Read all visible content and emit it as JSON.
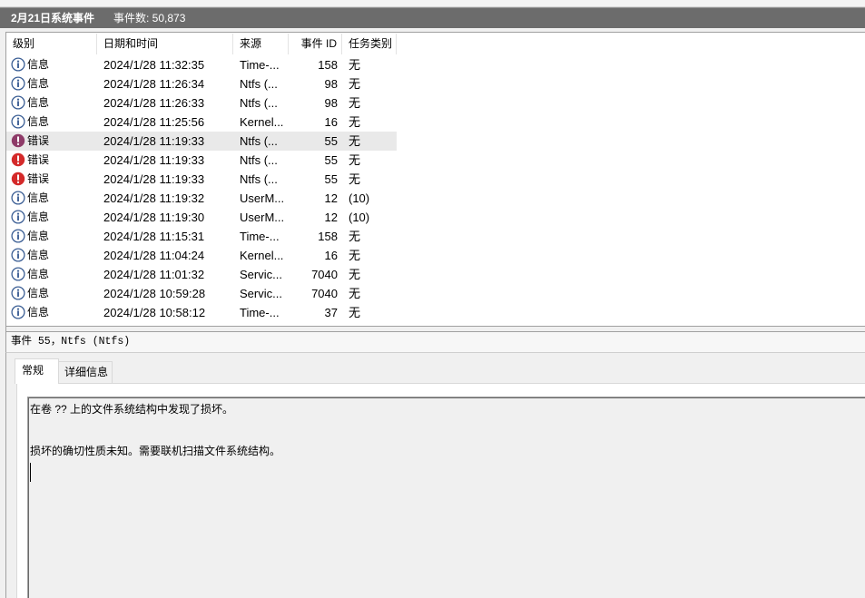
{
  "header": {
    "title": "2月21日系统事件",
    "count_label": "事件数: 50,873"
  },
  "table": {
    "columns": [
      "级别",
      "日期和时间",
      "来源",
      "事件 ID",
      "任务类别"
    ],
    "rows": [
      {
        "icon": "info-icon",
        "level": "信息",
        "datetime": "2024/1/28 11:32:35",
        "source": "Time-...",
        "event_id": "158",
        "task": "无"
      },
      {
        "icon": "info-icon",
        "level": "信息",
        "datetime": "2024/1/28 11:26:34",
        "source": "Ntfs (...",
        "event_id": "98",
        "task": "无"
      },
      {
        "icon": "info-icon",
        "level": "信息",
        "datetime": "2024/1/28 11:26:33",
        "source": "Ntfs (...",
        "event_id": "98",
        "task": "无"
      },
      {
        "icon": "info-icon",
        "level": "信息",
        "datetime": "2024/1/28 11:25:56",
        "source": "Kernel...",
        "event_id": "16",
        "task": "无"
      },
      {
        "icon": "error-icon",
        "level": "错误",
        "datetime": "2024/1/28 11:19:33",
        "source": "Ntfs (...",
        "event_id": "55",
        "task": "无",
        "selected": true
      },
      {
        "icon": "error-icon",
        "level": "错误",
        "datetime": "2024/1/28 11:19:33",
        "source": "Ntfs (...",
        "event_id": "55",
        "task": "无"
      },
      {
        "icon": "error-icon",
        "level": "错误",
        "datetime": "2024/1/28 11:19:33",
        "source": "Ntfs (...",
        "event_id": "55",
        "task": "无"
      },
      {
        "icon": "info-icon",
        "level": "信息",
        "datetime": "2024/1/28 11:19:32",
        "source": "UserM...",
        "event_id": "12",
        "task": "(10)"
      },
      {
        "icon": "info-icon",
        "level": "信息",
        "datetime": "2024/1/28 11:19:30",
        "source": "UserM...",
        "event_id": "12",
        "task": "(10)"
      },
      {
        "icon": "info-icon",
        "level": "信息",
        "datetime": "2024/1/28 11:15:31",
        "source": "Time-...",
        "event_id": "158",
        "task": "无"
      },
      {
        "icon": "info-icon",
        "level": "信息",
        "datetime": "2024/1/28 11:04:24",
        "source": "Kernel...",
        "event_id": "16",
        "task": "无"
      },
      {
        "icon": "info-icon",
        "level": "信息",
        "datetime": "2024/1/28 11:01:32",
        "source": "Servic...",
        "event_id": "7040",
        "task": "无"
      },
      {
        "icon": "info-icon",
        "level": "信息",
        "datetime": "2024/1/28 10:59:28",
        "source": "Servic...",
        "event_id": "7040",
        "task": "无"
      },
      {
        "icon": "info-icon",
        "level": "信息",
        "datetime": "2024/1/28 10:58:12",
        "source": "Time-...",
        "event_id": "37",
        "task": "无"
      }
    ]
  },
  "detail": {
    "title": "事件 55，Ntfs (Ntfs)",
    "tabs": [
      {
        "label": "常规",
        "active": true
      },
      {
        "label": "详细信息",
        "active": false
      }
    ],
    "description": [
      "在卷 ?? 上的文件系统结构中发现了损坏。",
      "损坏的确切性质未知。需要联机扫描文件系统结构。"
    ]
  },
  "colors": {
    "title_bar_bg": "#6c6c6c",
    "selected_row_bg": "#e9e9e9",
    "info_icon": "#3c5f95",
    "error_icon": "#d42a2a",
    "error_icon_selected": "#8e3b68"
  }
}
